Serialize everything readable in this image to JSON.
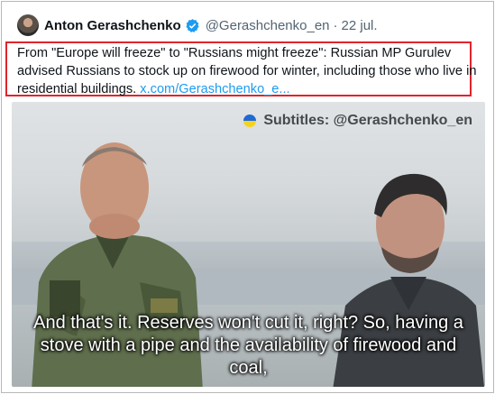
{
  "tweet": {
    "author_name": "Anton Gerashchenko",
    "handle": "@Gerashchenko_en",
    "separator": "·",
    "date": "22 jul.",
    "text_main": "From \"Europe will freeze\" to \"Russians might freeze\": Russian MP Gurulev advised Russians to stock up on firewood for winter, including those who live in residential buildings. ",
    "link_text": "x.com/Gerashchenko_e...",
    "verified_color": "#1d9bf0",
    "highlight_color": "#e0242b"
  },
  "video": {
    "watermark": "Subtitles: @Gerashchenko_en",
    "caption_line1": "And that's it. Reserves won't cut it, right? So, having a",
    "caption_line2": "stove with a pipe and the availability of firewood and",
    "caption_line3": "coal,"
  }
}
